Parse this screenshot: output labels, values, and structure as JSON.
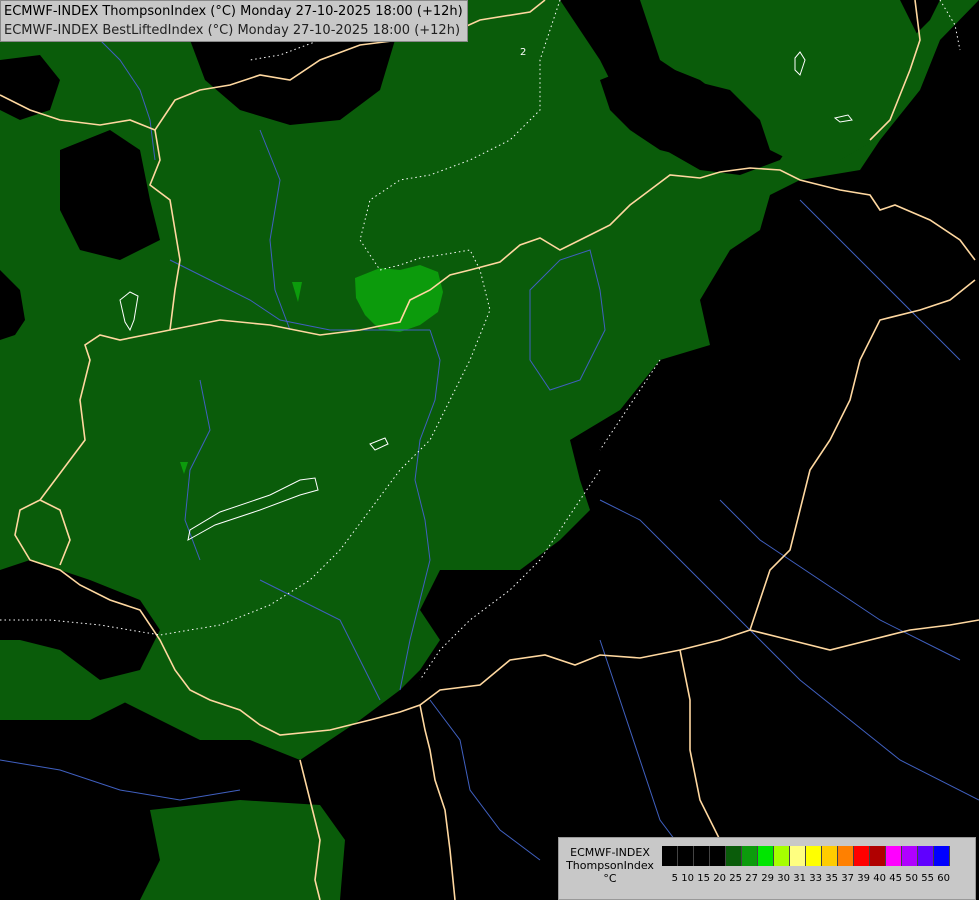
{
  "title": {
    "line1": "ECMWF-INDEX ThompsonIndex (°C) Monday 27-10-2025 18:00 (+12h)",
    "line2": "ECMWF-INDEX BestLiftedIndex (°C) Monday 27-10-2025 18:00 (+12h)"
  },
  "map": {
    "background_color": "#000000",
    "field_color_dark": "#0a5c0a",
    "field_color_mid": "#0c9b0c",
    "border_color": "#ffd8a0",
    "river_color": "#4060c0",
    "contour_color": "#ffffff",
    "contour_label": "2"
  },
  "legend": {
    "line1": "ECMWF-INDEX",
    "line2": "ThompsonIndex",
    "line3": "°C",
    "bins": [
      {
        "label": "5",
        "color": "#000000"
      },
      {
        "label": "10",
        "color": "#000000"
      },
      {
        "label": "15",
        "color": "#000000"
      },
      {
        "label": "20",
        "color": "#000000"
      },
      {
        "label": "25",
        "color": "#0a5c0a"
      },
      {
        "label": "27",
        "color": "#0c9b0c"
      },
      {
        "label": "29",
        "color": "#00e600"
      },
      {
        "label": "30",
        "color": "#a6ff00"
      },
      {
        "label": "31",
        "color": "#ffff80"
      },
      {
        "label": "33",
        "color": "#ffff00"
      },
      {
        "label": "35",
        "color": "#ffcc00"
      },
      {
        "label": "37",
        "color": "#ff8000"
      },
      {
        "label": "39",
        "color": "#ff0000"
      },
      {
        "label": "40",
        "color": "#b00000"
      },
      {
        "label": "45",
        "color": "#ff00ff"
      },
      {
        "label": "50",
        "color": "#b000ff"
      },
      {
        "label": "55",
        "color": "#6000ff"
      },
      {
        "label": "60",
        "color": "#0000ff"
      }
    ]
  }
}
